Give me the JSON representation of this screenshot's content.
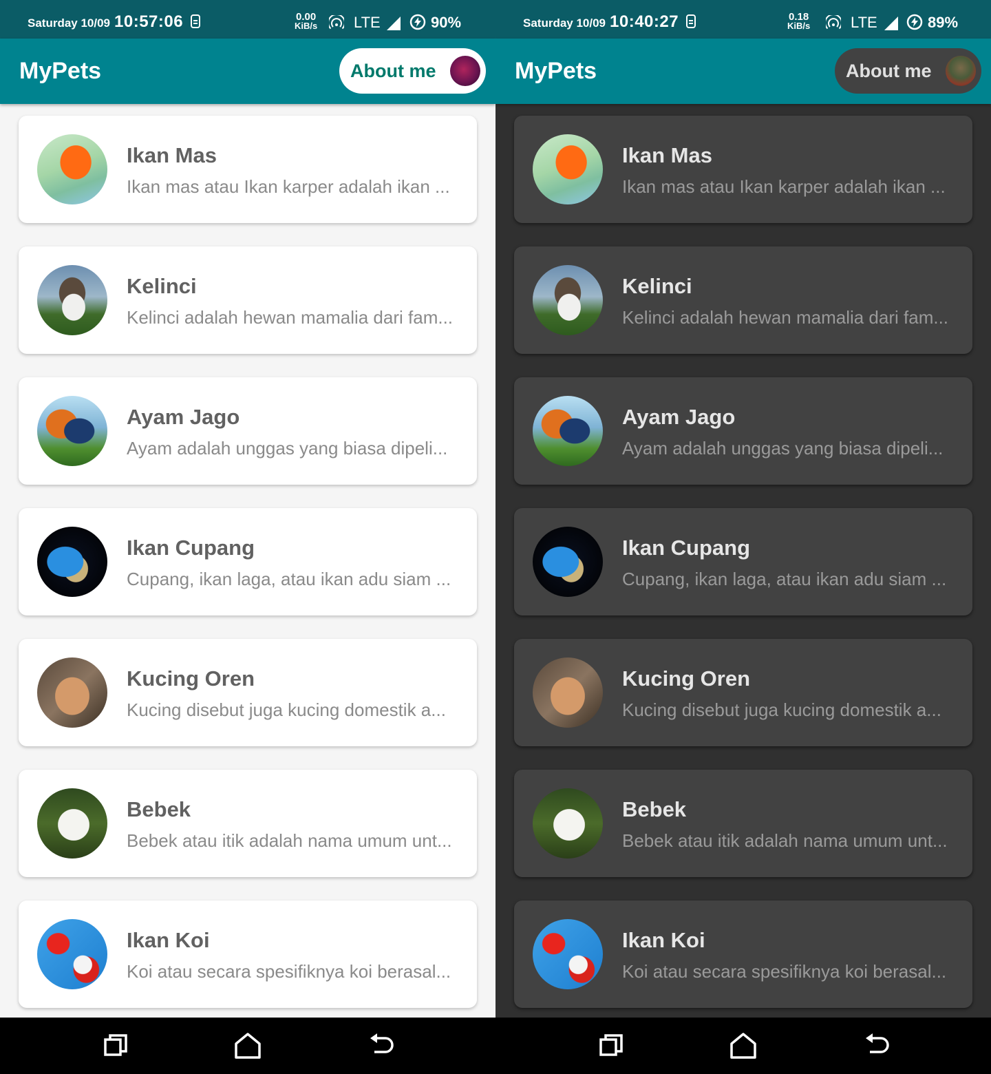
{
  "panes": [
    {
      "theme": "light",
      "status": {
        "day": "Saturday 10/09",
        "time": "10:57:06",
        "speed_value": "0.00",
        "speed_unit": "KiB/s",
        "network": "LTE",
        "battery": "90%"
      },
      "app": {
        "title": "MyPets",
        "about_label": "About me",
        "about_avatar_icon": "profile-avatar"
      },
      "pets": [
        {
          "name": "Ikan Mas",
          "desc": "Ikan mas atau Ikan karper adalah ikan ..."
        },
        {
          "name": "Kelinci",
          "desc": "Kelinci adalah hewan mamalia dari fam..."
        },
        {
          "name": "Ayam Jago",
          "desc": "Ayam adalah unggas yang biasa dipeli..."
        },
        {
          "name": "Ikan Cupang",
          "desc": "Cupang, ikan laga, atau ikan adu siam ..."
        },
        {
          "name": "Kucing Oren",
          "desc": "Kucing disebut juga kucing domestik a..."
        },
        {
          "name": "Bebek",
          "desc": "Bebek atau itik adalah nama umum unt..."
        },
        {
          "name": "Ikan Koi",
          "desc": "Koi atau secara spesifiknya koi berasal..."
        }
      ]
    },
    {
      "theme": "dark",
      "status": {
        "day": "Saturday 10/09",
        "time": "10:40:27",
        "speed_value": "0.18",
        "speed_unit": "KiB/s",
        "network": "LTE",
        "battery": "89%"
      },
      "app": {
        "title": "MyPets",
        "about_label": "About me",
        "about_avatar_icon": "profile-avatar"
      },
      "pets": [
        {
          "name": "Ikan Mas",
          "desc": "Ikan mas atau Ikan karper adalah ikan ..."
        },
        {
          "name": "Kelinci",
          "desc": "Kelinci adalah hewan mamalia dari fam..."
        },
        {
          "name": "Ayam Jago",
          "desc": "Ayam adalah unggas yang biasa dipeli..."
        },
        {
          "name": "Ikan Cupang",
          "desc": "Cupang, ikan laga, atau ikan adu siam ..."
        },
        {
          "name": "Kucing Oren",
          "desc": "Kucing disebut juga kucing domestik a..."
        },
        {
          "name": "Bebek",
          "desc": "Bebek atau itik adalah nama umum unt..."
        },
        {
          "name": "Ikan Koi",
          "desc": "Koi atau secara spesifiknya koi berasal..."
        }
      ]
    }
  ],
  "colors": {
    "status_bar": "#0b5c66",
    "app_bar": "#00838f",
    "light_bg": "#f5f5f5",
    "dark_bg": "#303030",
    "dark_card": "#424242",
    "accent_text": "#00796b"
  },
  "nav_icons": [
    "recents-icon",
    "home-icon",
    "back-icon"
  ]
}
